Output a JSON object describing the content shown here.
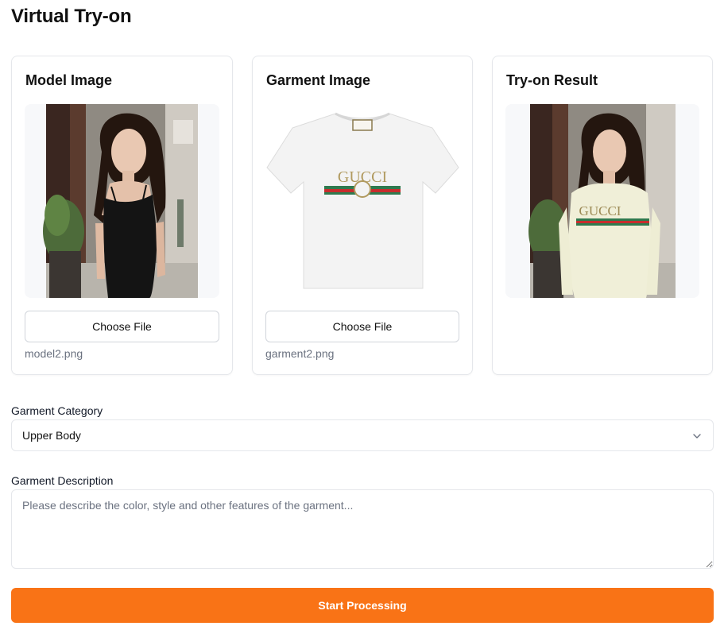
{
  "page": {
    "title": "Virtual Try-on"
  },
  "cards": {
    "model": {
      "title": "Model Image",
      "button": "Choose File",
      "file_name": "model2.png"
    },
    "garment": {
      "title": "Garment Image",
      "button": "Choose File",
      "file_name": "garment2.png",
      "logo_text": "GUCCI"
    },
    "result": {
      "title": "Try-on Result",
      "shirt_text": "GUCCI"
    }
  },
  "form": {
    "category_label": "Garment Category",
    "category_value": "Upper Body",
    "description_label": "Garment Description",
    "description_placeholder": "Please describe the color, style and other features of the garment..."
  },
  "actions": {
    "submit_label": "Start Processing"
  },
  "colors": {
    "accent": "#f97316"
  }
}
